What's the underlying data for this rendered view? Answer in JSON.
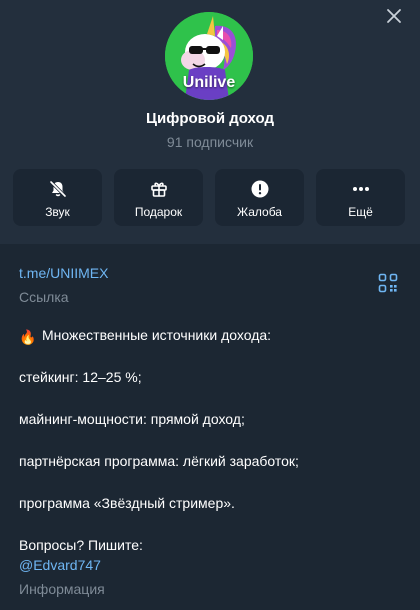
{
  "channel": {
    "avatar_text": "Unilive",
    "name": "Цифровой доход",
    "subscribers": "91 подписчик"
  },
  "actions": [
    {
      "label": "Звук",
      "icon": "bell-off-icon"
    },
    {
      "label": "Подарок",
      "icon": "gift-icon"
    },
    {
      "label": "Жалоба",
      "icon": "alert-icon"
    },
    {
      "label": "Ещё",
      "icon": "more-icon"
    }
  ],
  "info": {
    "link": "t.me/UNIIMEX",
    "link_caption": "Ссылка",
    "description": {
      "emoji": "🔥",
      "line1": "Множественные источники дохода:",
      "line2": "стейкинг: 12–25 %;",
      "line3": "майнинг-мощности: прямой доход;",
      "line4": "партнёрская программа: лёгкий заработок;",
      "line5": "программа «Звёздный стример».",
      "line6": "Вопросы? Пишите:",
      "mention": "@Edvard747"
    },
    "description_caption": "Информация"
  },
  "colors": {
    "background": "#1c2733",
    "header": "#232f3d",
    "accent_link": "#6fb6f3",
    "muted": "#7f8b97"
  }
}
